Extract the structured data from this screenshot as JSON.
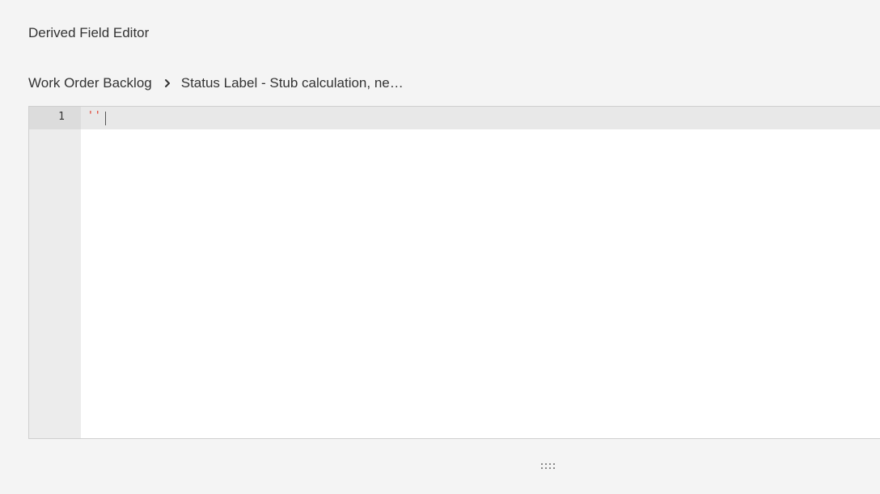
{
  "panel": {
    "title": "Derived Field Editor"
  },
  "breadcrumb": {
    "parent": "Work Order Backlog",
    "separator_icon": "chevron-right-icon",
    "current": "Status Label - Stub calculation, ne…"
  },
  "editor": {
    "lines": [
      {
        "number": "1",
        "text": "''"
      }
    ],
    "string_color": "#e0301e"
  },
  "resize_handle": {
    "icon": "drag-handle-icon",
    "glyph": "::::"
  }
}
